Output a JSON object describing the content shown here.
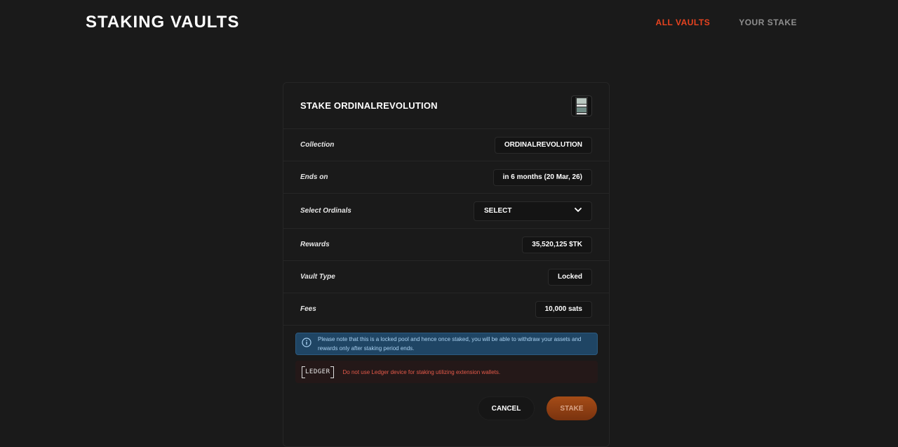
{
  "header": {
    "title": "STAKING VAULTS",
    "nav": [
      {
        "label": "ALL VAULTS",
        "active": true
      },
      {
        "label": "YOUR STAKE",
        "active": false
      }
    ]
  },
  "card": {
    "title": "STAKE ORDINALREVOLUTION",
    "rows": {
      "collection": {
        "label": "Collection",
        "value": "ORDINALREVOLUTION"
      },
      "ends_on": {
        "label": "Ends on",
        "value": "in 6 months (20 Mar, 26)"
      },
      "select_ordinals": {
        "label": "Select Ordinals",
        "value": "SELECT"
      },
      "rewards": {
        "label": "Rewards",
        "value": "35,520,125 $TK"
      },
      "vault_type": {
        "label": "Vault Type",
        "value": "Locked"
      },
      "fees": {
        "label": "Fees",
        "value": "10,000 sats"
      }
    },
    "info_notice": "Please note that this is a locked pool and hence once staked, you will be able to withdraw your assets and rewards only after staking period ends.",
    "ledger_warning": {
      "logo_text": "LEDGER",
      "text": "Do not use Ledger device for staking utilizing extension wallets."
    },
    "buttons": {
      "cancel": "CANCEL",
      "stake": "STAKE"
    }
  },
  "colors": {
    "accent": "#e8431f",
    "background": "#1a1a1a",
    "info_bg": "#1f4564",
    "warning_text": "#e55a4a"
  },
  "icons": {
    "info": "info-circle-icon",
    "chevron": "chevron-down-icon",
    "collection_thumb": "collection-thumbnail"
  }
}
